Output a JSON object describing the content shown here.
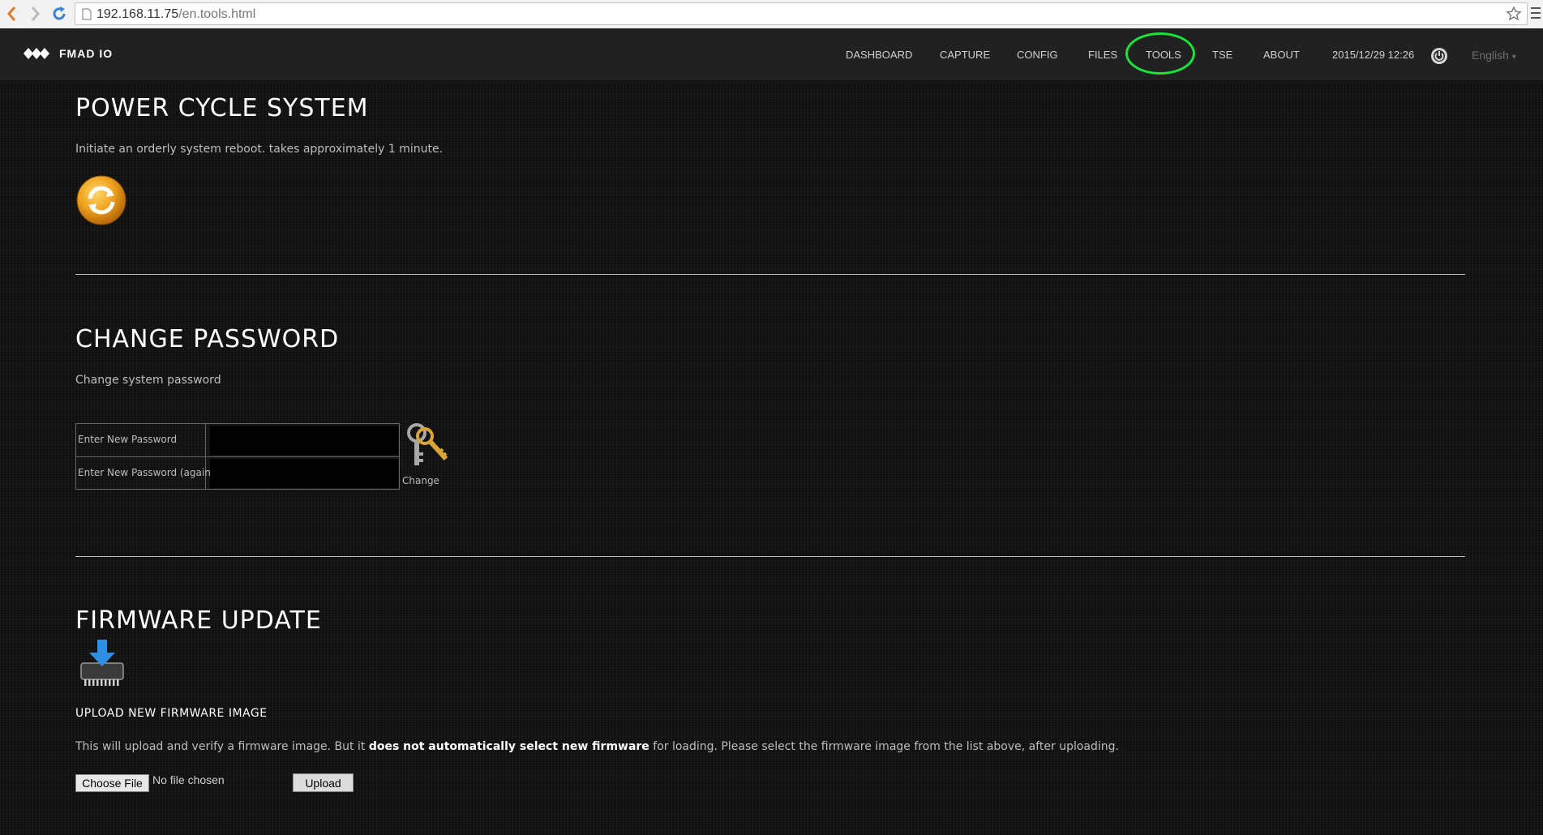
{
  "browser": {
    "url_host": "192.168.11.75",
    "url_path": "/en.tools.html"
  },
  "navbar": {
    "brand": "FMAD IO",
    "items": [
      "DASHBOARD",
      "CAPTURE",
      "CONFIG",
      "FILES",
      "TOOLS",
      "TSE",
      "ABOUT"
    ],
    "datetime": "2015/12/29 12:26",
    "language": "English"
  },
  "power_cycle": {
    "title": "POWER CYCLE SYSTEM",
    "description": "Initiate an orderly system reboot. takes approximately 1 minute."
  },
  "change_password": {
    "title": "CHANGE PASSWORD",
    "description": "Change system password",
    "label_new": "Enter New Password",
    "label_again": "Enter New Password (again)",
    "button_label": "Change"
  },
  "firmware": {
    "title": "FIRMWARE UPDATE",
    "subtitle": "UPLOAD NEW FIRMWARE IMAGE",
    "desc_pre": "This will upload and verify a firmware image. But it ",
    "desc_bold": "does not automatically select new firmware",
    "desc_post": " for loading. Please select the firmware image from the list above, after uploading.",
    "choose_file_label": "Choose File",
    "file_status": "No file chosen",
    "upload_label": "Upload"
  }
}
